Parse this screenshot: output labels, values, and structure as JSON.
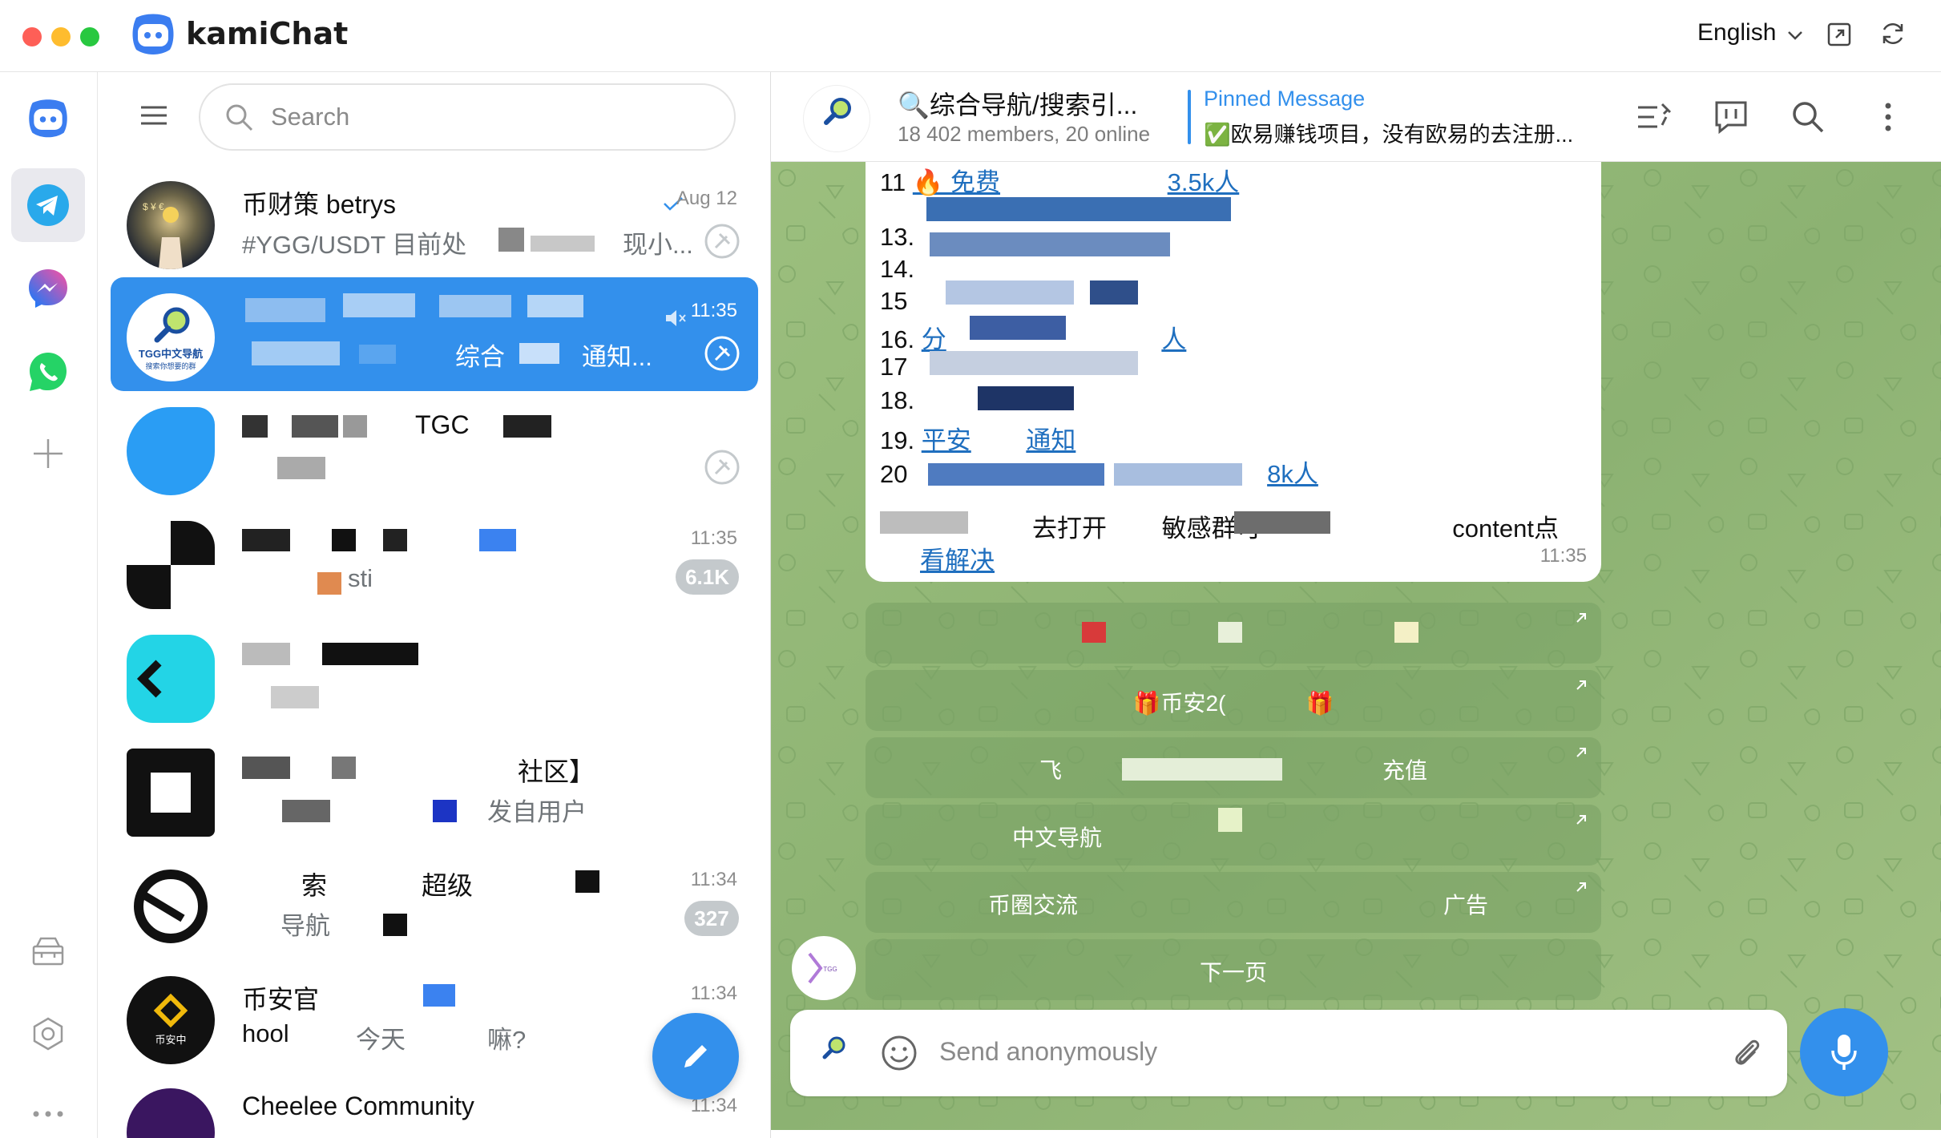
{
  "app": {
    "title": "kamiChat",
    "language": "English",
    "icons": [
      "kamichat-logo-icon",
      "chevron-down-icon",
      "open-external-icon",
      "refresh-icon"
    ]
  },
  "rail": {
    "items": [
      "kamichat-icon",
      "telegram-icon",
      "messenger-icon",
      "whatsapp-icon",
      "add-icon",
      "toolbox-icon",
      "settings-icon",
      "more-icon"
    ],
    "active": "telegram-icon"
  },
  "search": {
    "placeholder": "Search"
  },
  "chats": [
    {
      "title": "币财策 betrys",
      "preview": "#YGG/USDT 目前处",
      "preview_tail": "现小...",
      "time": "Aug 12",
      "read": true,
      "pinned": true
    },
    {
      "title": "",
      "preview_mid": "综合",
      "preview_tail": "通知...",
      "time": "11:35",
      "muted": true,
      "pinned": true,
      "selected": true,
      "avatar_text_1": "TGG中文导航",
      "avatar_text_2": "搜索你想要的群"
    },
    {
      "title_fragment": "TGC",
      "pinned": true
    },
    {
      "time": "11:35",
      "fragment": "sti",
      "badge": "6.1K"
    },
    {
      "title_fragment": ""
    },
    {
      "title_fragment": "社区】",
      "preview_fragment": "发自用户"
    },
    {
      "title_fragment_1": "索",
      "title_fragment_2": "超级",
      "preview_fragment": "导航",
      "time": "11:34",
      "badge": "327"
    },
    {
      "title_fragment": "币安官",
      "preview_1": "hool",
      "preview_2": "今天",
      "preview_3": "嘛?",
      "time": "11:34",
      "avatar_text": "币安中"
    },
    {
      "title": "Cheelee Community",
      "time": "11:34",
      "muted": true
    }
  ],
  "header": {
    "title": "🔍综合导航/搜索引...",
    "subtitle": "18 402 members, 20 online",
    "pinned_label": "Pinned Message",
    "pinned_text": "✅欧易赚钱项目，没有欧易的去注册...",
    "icons": [
      "unpin-list-icon",
      "channel-comments-icon",
      "search-icon",
      "more-vertical-icon"
    ]
  },
  "message": {
    "lines": [
      {
        "num": "11",
        "link": "🔥 免费",
        "tail": "3.5k人"
      },
      {
        "num": "13.",
        "text": ""
      },
      {
        "num": "14.",
        "text": ""
      },
      {
        "num": "15",
        "text": ""
      },
      {
        "num": "16.",
        "text": "分",
        "tail": "人"
      },
      {
        "num": "17",
        "text": ""
      },
      {
        "num": "18.",
        "text": ""
      },
      {
        "num": "19.",
        "link": "平安",
        "tail": "通知"
      },
      {
        "num": "20",
        "text": "",
        "tail": "8k人"
      }
    ],
    "footer_text_1": "去打开",
    "footer_text_2": "敏感群可",
    "footer_text_3": "content点",
    "footer_text_4": "看解决",
    "time": "11:35"
  },
  "inline_buttons": [
    {
      "label": ""
    },
    {
      "label": "🎁币安2(",
      "suffix": "🎁"
    },
    {
      "label": "飞",
      "suffix": "充值"
    },
    {
      "label": "中文导航"
    },
    {
      "label": "币圈交流",
      "suffix": "广告"
    },
    {
      "label": "下一页"
    }
  ],
  "composer": {
    "placeholder": "Send anonymously"
  },
  "colors": {
    "accent": "#3390ec",
    "chat_bg": "#8fb573",
    "link": "#1f6fbf"
  }
}
